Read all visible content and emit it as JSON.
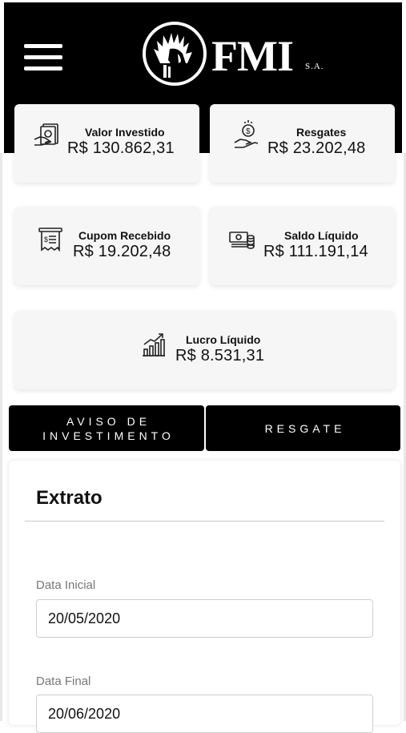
{
  "header": {
    "logo_text": "FMI",
    "logo_sub": "S.A."
  },
  "cards": {
    "valor_investido": {
      "label": "Valor Investido",
      "value": "R$ 130.862,31",
      "icon": "cash-hand-icon"
    },
    "resgates": {
      "label": "Resgates",
      "value": "R$ 23.202,48",
      "icon": "coin-hand-icon"
    },
    "cupom_recebido": {
      "label": "Cupom Recebido",
      "value": "R$ 19.202,48",
      "icon": "receipt-icon"
    },
    "saldo_liquido": {
      "label": "Saldo Líquido",
      "value": "R$ 111.191,14",
      "icon": "money-stack-icon"
    },
    "lucro_liquido": {
      "label": "Lucro Líquido",
      "value": "R$ 8.531,31",
      "icon": "growth-chart-icon"
    }
  },
  "tabs": {
    "aviso_line1": "AVISO DE",
    "aviso_line2": "INVESTIMENTO",
    "resgate": "RESGATE"
  },
  "extrato": {
    "title": "Extrato",
    "data_inicial_label": "Data Inicial",
    "data_inicial_value": "20/05/2020",
    "data_final_label": "Data Final",
    "data_final_value": "20/06/2020"
  },
  "colors": {
    "header_bg": "#000000",
    "card_bg": "#f6f6f6",
    "tab_bg": "#000000"
  }
}
